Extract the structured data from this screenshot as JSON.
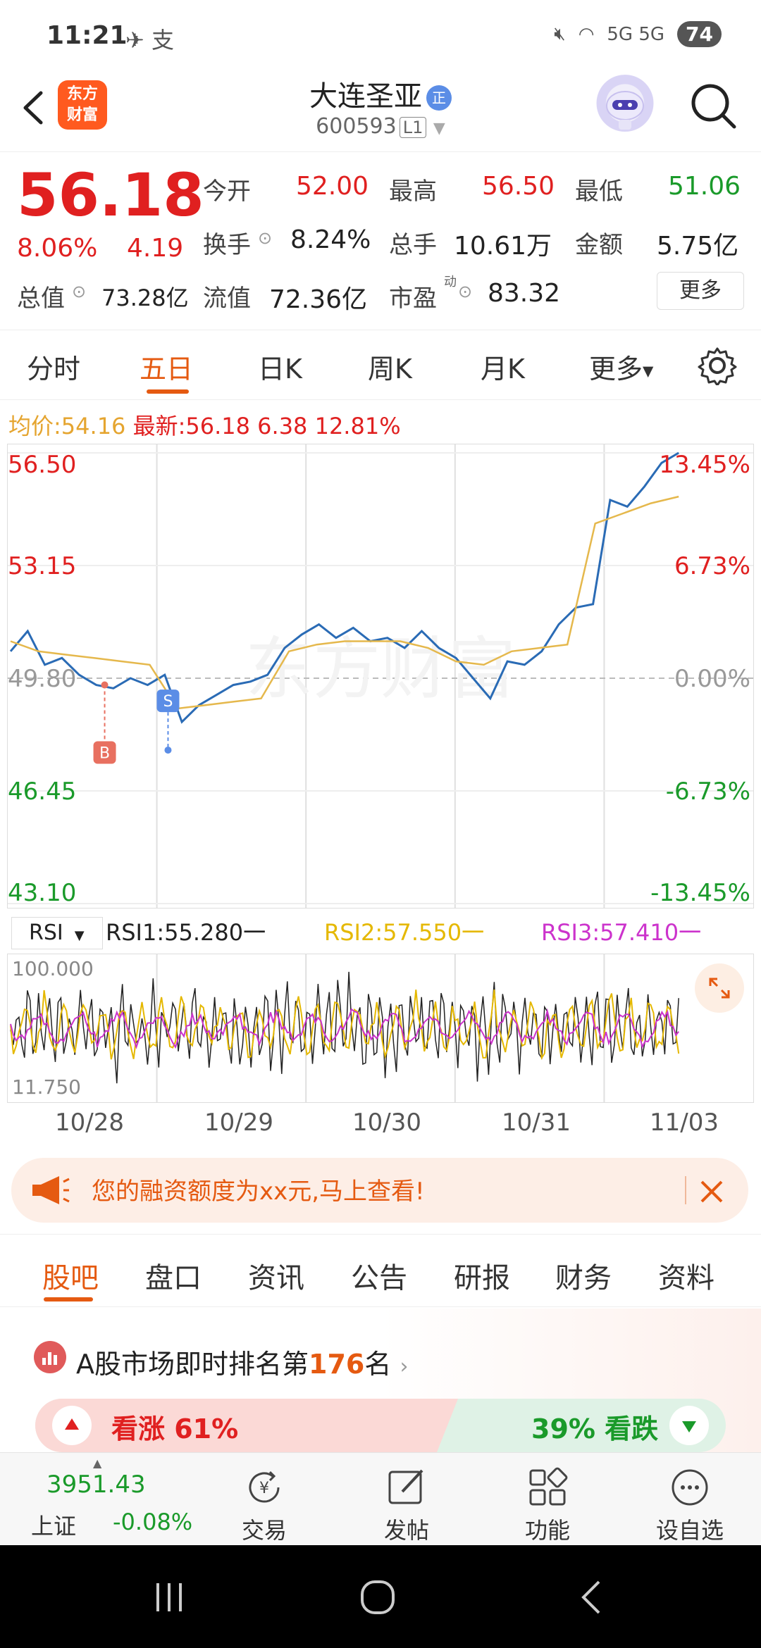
{
  "status_bar": {
    "time": "11:21",
    "notifications": "✈ 支",
    "battery": "74",
    "signal": "5G 5G"
  },
  "header": {
    "logo_text_1": "东方",
    "logo_text_2": "财富",
    "stock_name": "大连圣亚",
    "stock_badge": "正",
    "stock_code": "600593",
    "level": "L1"
  },
  "quote": {
    "price": "56.18",
    "change_pct": "8.06%",
    "change_abs": "4.19",
    "open_label": "今开",
    "open": "52.00",
    "high_label": "最高",
    "high": "56.50",
    "low_label": "最低",
    "low": "51.06",
    "turnover_label": "换手",
    "turnover": "8.24%",
    "volume_label": "总手",
    "volume": "10.61万",
    "amount_label": "金额",
    "amount": "5.75亿",
    "mcap_label": "总值",
    "mcap": "73.28亿",
    "float_label": "流值",
    "float": "72.36亿",
    "pe_label": "市盈",
    "pe_sup": "动",
    "pe": "83.32",
    "more": "更多"
  },
  "tabs": [
    "分时",
    "五日",
    "日K",
    "周K",
    "月K",
    "更多"
  ],
  "chart_info": {
    "avg_label": "均价:",
    "avg": "54.16",
    "latest_label": "最新:",
    "latest": "56.18",
    "chg": "6.38",
    "chg_pct": "12.81%"
  },
  "chart_data": {
    "type": "line",
    "x": [
      "10/28",
      "10/29",
      "10/30",
      "10/31",
      "11/03"
    ],
    "y_left_ticks": [
      "56.50",
      "53.15",
      "49.80",
      "46.45",
      "43.10"
    ],
    "y_right_ticks": [
      "13.45%",
      "6.73%",
      "0.00%",
      "-6.73%",
      "-13.45%"
    ],
    "ylim": [
      43.1,
      56.5
    ],
    "prev_close": 49.8,
    "series": [
      {
        "values": [
          50.6,
          51.2,
          50.2,
          50.4,
          49.9,
          49.6,
          49.5,
          49.8,
          49.6,
          49.9,
          48.5,
          49.0,
          49.3,
          49.6,
          49.7,
          49.9,
          50.7,
          51.1,
          51.4,
          51.0,
          51.3,
          50.9,
          51.0,
          50.7,
          51.2,
          50.7,
          50.4,
          49.8,
          49.2,
          50.3,
          50.2,
          50.6,
          51.4,
          51.9,
          52.0,
          55.1,
          54.9,
          55.5,
          56.2,
          56.5
        ]
      },
      {
        "values": [
          50.9,
          50.6,
          50.5,
          50.4,
          50.3,
          50.2,
          48.9,
          49.0,
          49.1,
          49.2,
          50.6,
          50.8,
          50.9,
          50.9,
          50.9,
          50.7,
          50.3,
          50.2,
          50.6,
          50.7,
          50.8,
          54.4,
          54.7,
          55.0,
          55.2
        ]
      }
    ],
    "markers": [
      {
        "label": "B",
        "color": "#e87060"
      },
      {
        "label": "S",
        "color": "#5b8de6"
      }
    ]
  },
  "rsi": {
    "selector": "RSI",
    "rsi1": "RSI1:55.280一",
    "rsi2": "RSI2:57.550一",
    "rsi3": "RSI3:57.410一",
    "top": "100.000",
    "bottom": "11.750",
    "colors": {
      "rsi1": "#222222",
      "rsi2": "#e5b800",
      "rsi3": "#cc33cc"
    }
  },
  "banner": {
    "text": "您的融资额度为xx元,马上查看!"
  },
  "subtabs": [
    "股吧",
    "盘口",
    "资讯",
    "公告",
    "研报",
    "财务",
    "资料"
  ],
  "rank": {
    "prefix": "A股市场即时排名第",
    "num": "176",
    "suffix": "名"
  },
  "vote": {
    "up": "看涨 61%",
    "down": "39% 看跌",
    "up_pct": 61
  },
  "bottom_bar": {
    "index_value": "3951.43",
    "index_name": "上证",
    "index_change": "-0.08%",
    "buttons": [
      "交易",
      "发帖",
      "功能",
      "设自选"
    ]
  },
  "colors": {
    "up": "#e02020",
    "down": "#1a9a2a",
    "accent": "#e55a11",
    "price_line": "#2a6bb5",
    "avg_line": "#e5b84c"
  }
}
